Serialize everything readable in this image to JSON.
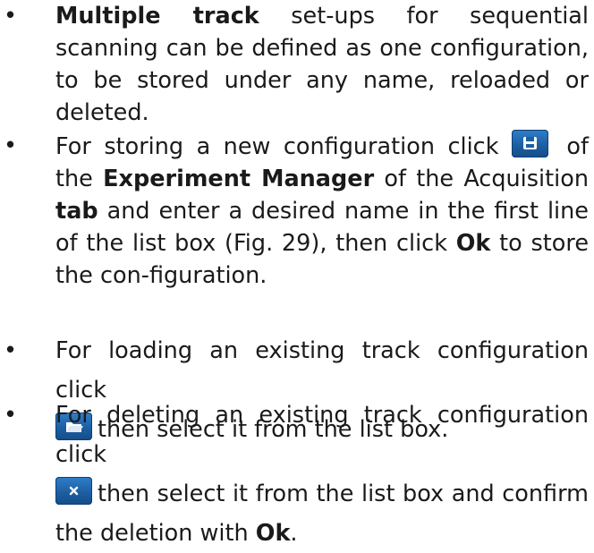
{
  "icons": {
    "save": "save-icon",
    "open": "open-folder-icon",
    "delete": "delete-icon",
    "button_color": "#1d5fa3"
  },
  "items": [
    {
      "bold_1": "Multiple track",
      "text_1": " set-ups for sequential scanning can be defined as one configuration, to be stored under any name, reloaded or deleted."
    },
    {
      "text_1": "For storing a new configuration click ",
      "text_2": " of the ",
      "bold_1": "Experiment Manager",
      "text_3": " of the Acquisition ",
      "bold_2": "tab",
      "text_4": " and enter a desired name in the first line of the list box (Fig. 29), then click ",
      "bold_3": "Ok",
      "text_5": " to store the con-figuration."
    },
    {
      "text_1": "For loading an existing track configuration click ",
      "text_2": "then select it from the list box."
    },
    {
      "text_1": "For deleting an existing track configuration click ",
      "text_2": "then select it from the list box and confirm the deletion with ",
      "bold_1": "Ok",
      "text_3": "."
    }
  ]
}
